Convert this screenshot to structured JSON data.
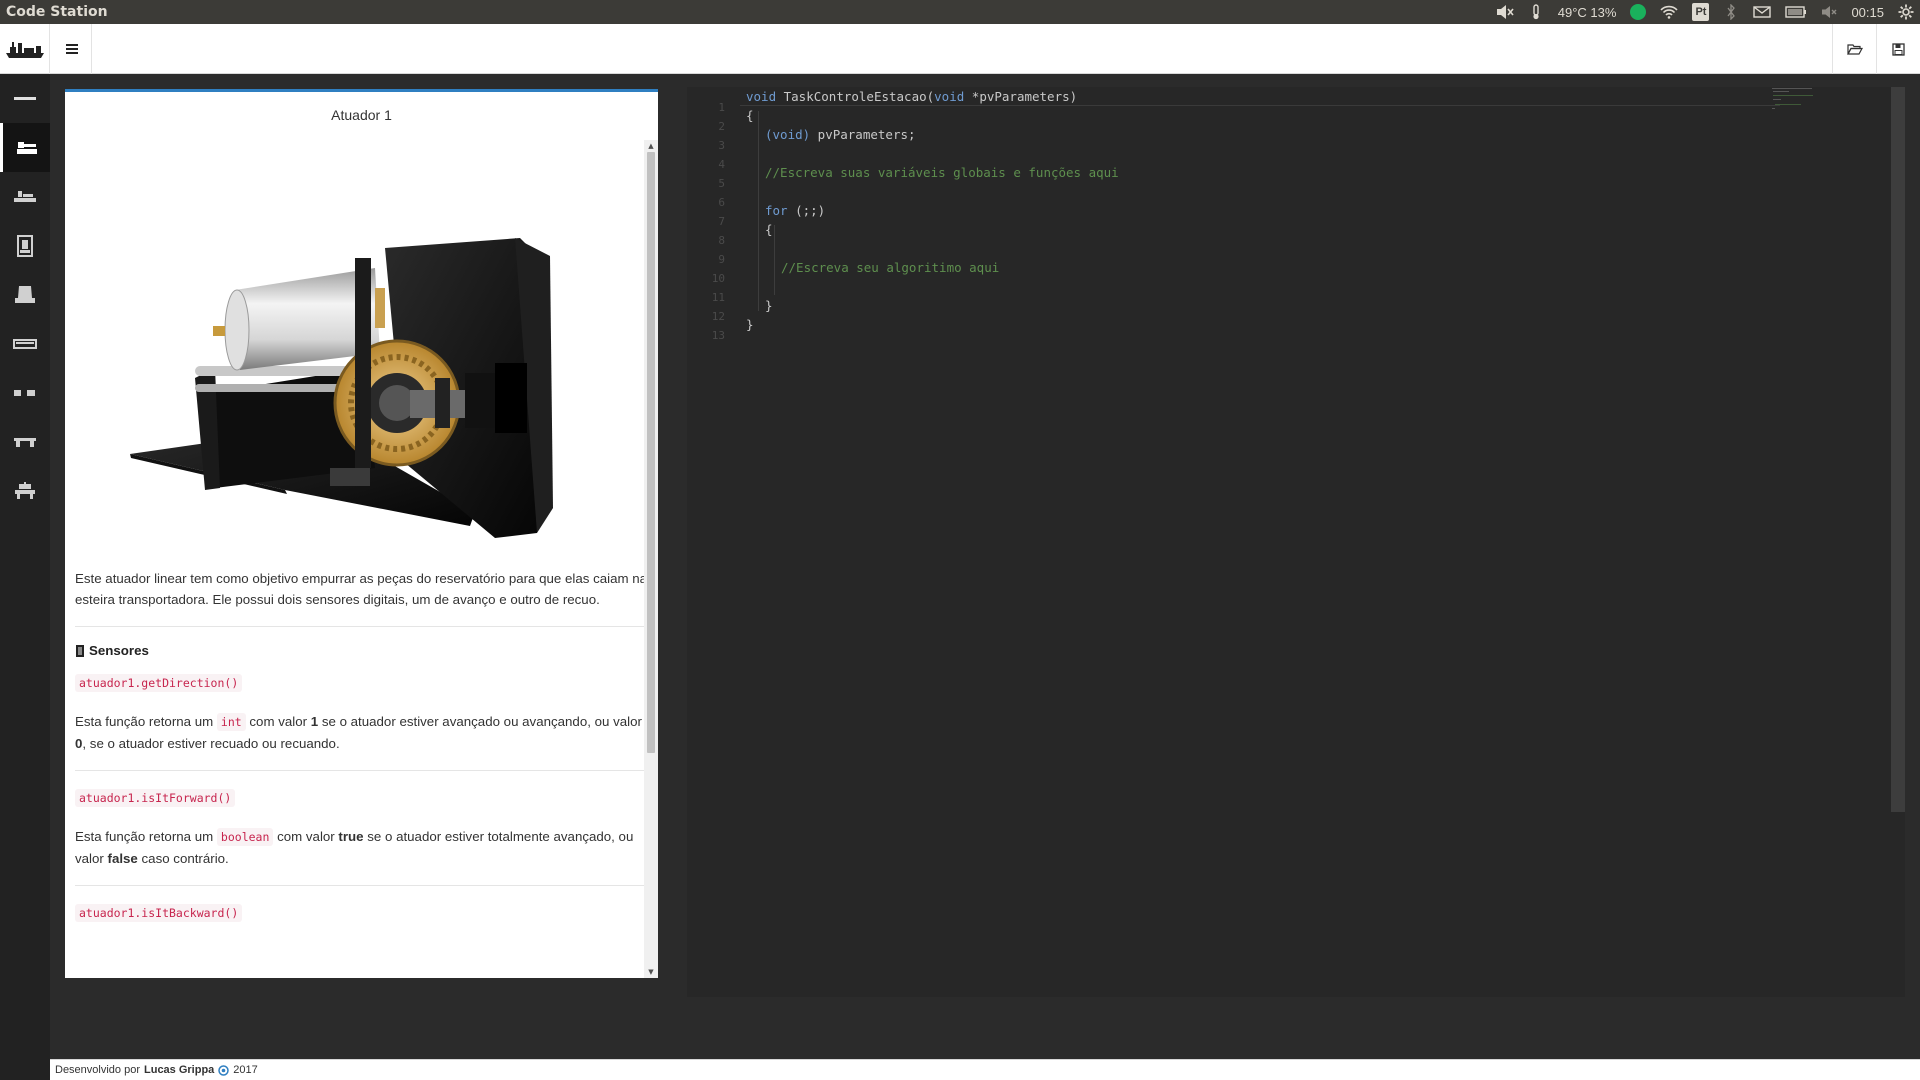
{
  "system_bar": {
    "app_title": "Code Station",
    "temperature": "49°C 13%",
    "keyboard_layout": "Pt",
    "clock": "00:15"
  },
  "navbar": {
    "menu_icon": "hamburger-icon",
    "open_icon": "folder-open-icon",
    "save_icon": "floppy-save-icon"
  },
  "sidebar": {
    "items": [
      {
        "icon": "minus-bar-icon"
      },
      {
        "icon": "actuator-icon",
        "active": true
      },
      {
        "icon": "station-icon"
      },
      {
        "icon": "reservoir-icon"
      },
      {
        "icon": "stamp-icon"
      },
      {
        "icon": "conveyor-icon"
      },
      {
        "icon": "sensor-icon"
      },
      {
        "icon": "bridge-icon"
      },
      {
        "icon": "robot-icon"
      }
    ]
  },
  "doc": {
    "title": "Atuador 1",
    "description": "Este atuador linear tem como objetivo empurrar as peças do reservatório para que elas caiam na esteira transportadora. Ele possui dois sensores digitais, um de avanço e outro de recuo.",
    "sensors_heading": "Sensores",
    "functions": [
      {
        "signature": "atuador1.getDirection()",
        "text_a": "Esta função retorna um ",
        "type": "int",
        "text_b": " com valor ",
        "value": "1",
        "text_c": "  se o atuador estiver avançado ou avançando, ou valor ",
        "value2": "0",
        "text_d": ", se o atuador estiver recuado ou recuando."
      },
      {
        "signature": "atuador1.isItForward()",
        "text_a": "Esta função retorna um ",
        "type": "boolean",
        "text_b": " com valor ",
        "value": "true",
        "text_c": "  se o atuador estiver totalmente avançado, ou valor ",
        "value2": "false",
        "text_d": " caso contrário."
      },
      {
        "signature": "atuador1.isItBackward()"
      }
    ]
  },
  "editor": {
    "line_numbers": [
      "1",
      "2",
      "3",
      "4",
      "5",
      "6",
      "7",
      "8",
      "9",
      "10",
      "11",
      "12",
      "13"
    ],
    "lines": [
      {
        "kw1": "void",
        "t1": " TaskControleEstacao(",
        "kw2": "void",
        "t2": " *pvParameters)"
      },
      {
        "t": "{"
      },
      {
        "kw": "(void)",
        "t": " pvParameters;"
      },
      {
        "t": ""
      },
      {
        "cm": "//Escreva suas variáveis globais e funções aqui"
      },
      {
        "t": ""
      },
      {
        "kw": "for",
        "t": " (;;)"
      },
      {
        "t": "{"
      },
      {
        "t": ""
      },
      {
        "cm": "//Escreva seu algoritimo aqui"
      },
      {
        "t": ""
      },
      {
        "t": "}"
      },
      {
        "t": "}"
      }
    ]
  },
  "footer": {
    "prefix": "Desenvolvido por",
    "author": "Lucas Grippa",
    "year": "2017"
  }
}
